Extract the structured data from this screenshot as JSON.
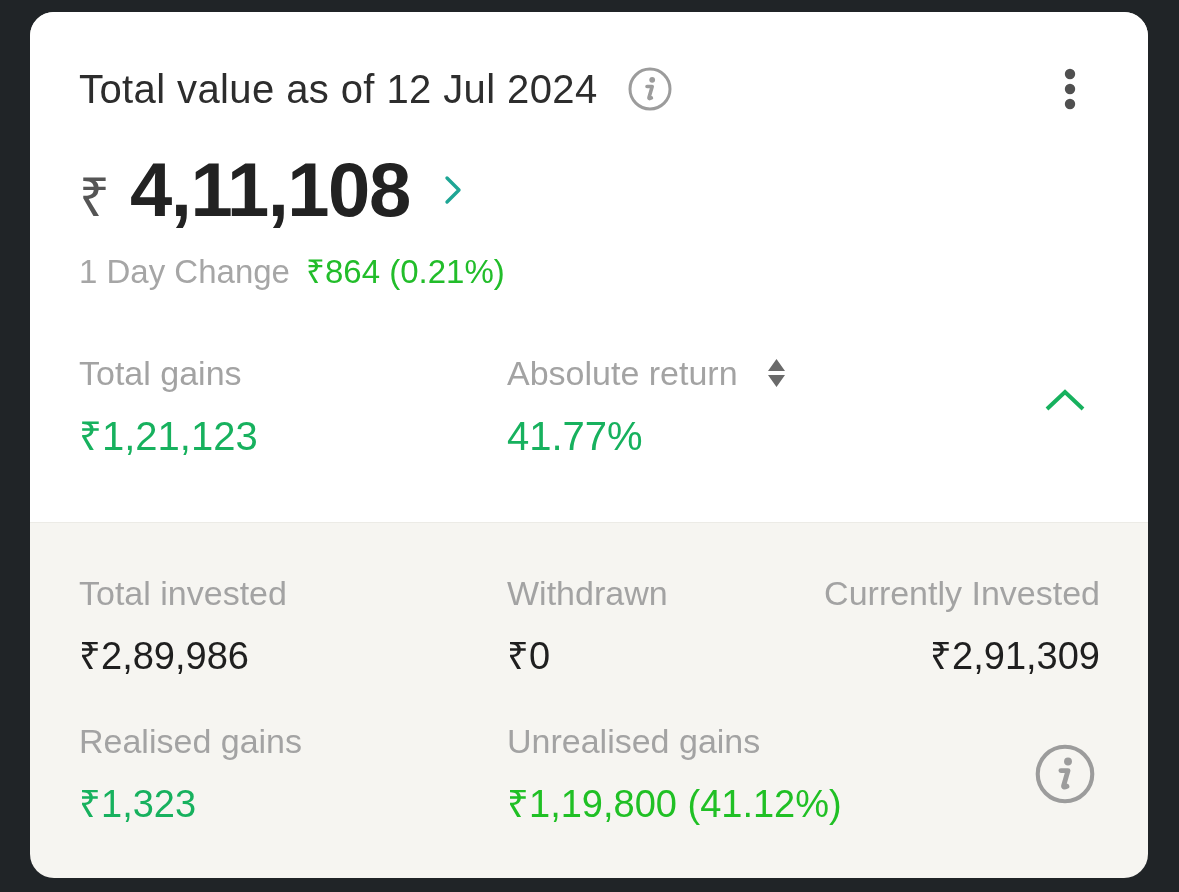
{
  "header": {
    "title": "Total value as of 12 Jul 2024"
  },
  "total": {
    "currency": "₹",
    "amount": "4,11,108"
  },
  "day_change": {
    "label": "1 Day Change",
    "value": "₹864 (0.21%)"
  },
  "summary": {
    "expanded": true,
    "stats": [
      {
        "label": "Total gains",
        "value": "₹1,21,123",
        "sortable": false
      },
      {
        "label": "Absolute return",
        "value": "41.77%",
        "sortable": true
      }
    ]
  },
  "details": {
    "stats": [
      {
        "label": "Total invested",
        "value": "₹2,89,986",
        "color": "#1f1f1f"
      },
      {
        "label": "Withdrawn",
        "value": "₹0",
        "color": "#1f1f1f"
      },
      {
        "label": "Currently Invested",
        "value": "₹2,91,309",
        "color": "#1f1f1f"
      },
      {
        "label": "Realised gains",
        "value": "₹1,323",
        "color": "#17b15e"
      },
      {
        "label": "Unrealised gains",
        "value": "₹1,19,800 (41.12%)",
        "color": "#20c025"
      }
    ]
  }
}
